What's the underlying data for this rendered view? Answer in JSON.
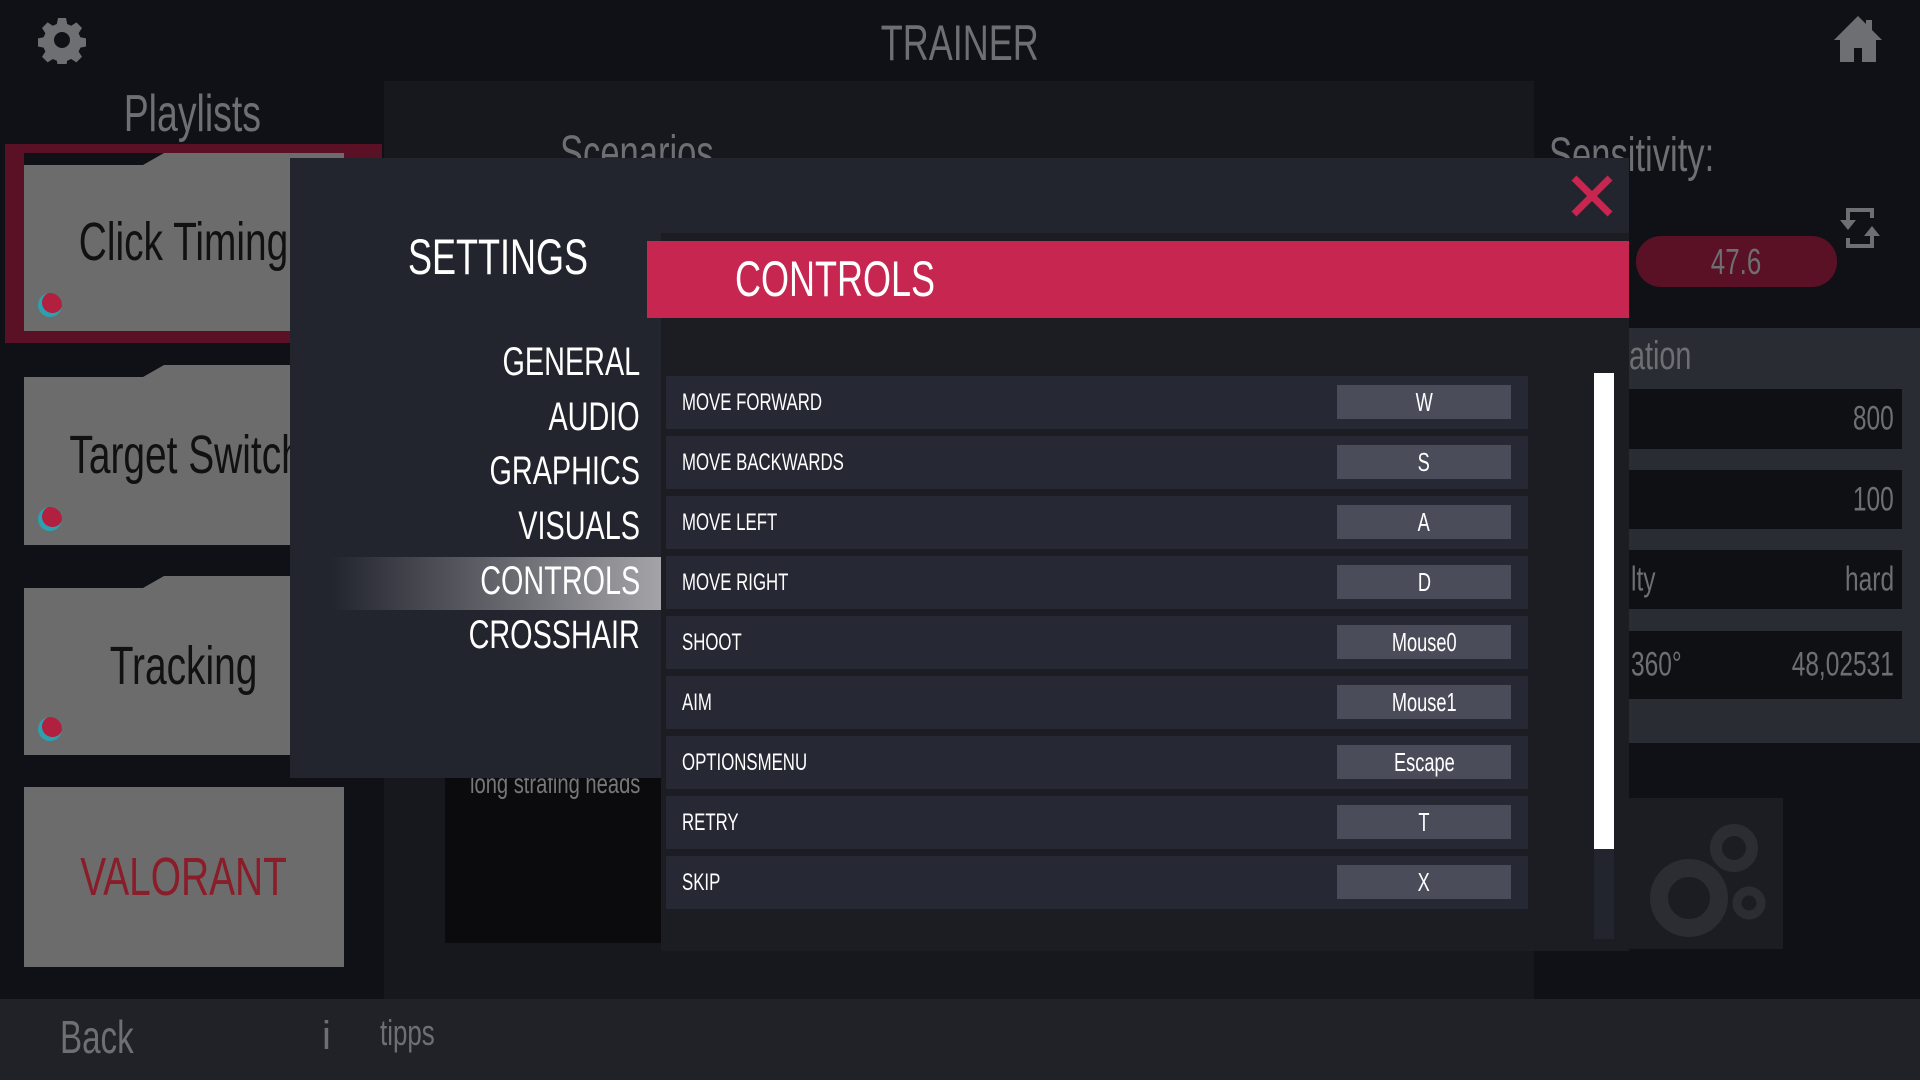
{
  "header": {
    "title": "TRAINER",
    "settings_icon": "gear-icon",
    "home_icon": "home-icon"
  },
  "playlists": {
    "title": "Playlists",
    "items": [
      {
        "label": "Click Timing",
        "selected": true
      },
      {
        "label": "Target Switch"
      },
      {
        "label": "Tracking"
      },
      {
        "label": "VALORANT"
      }
    ]
  },
  "scenarios": {
    "title": "Scenarios",
    "description": "long strafing heads"
  },
  "right_panel": {
    "sensitivity_label": "Sensitivity:",
    "sensitivity_value": "47.6",
    "section_label": "ation",
    "rows": [
      {
        "key": "",
        "value": "800"
      },
      {
        "key": "",
        "value": "100"
      },
      {
        "key": "lty",
        "value": "hard"
      },
      {
        "key": "360°",
        "value": "48,02531"
      }
    ]
  },
  "footer": {
    "back": "Back",
    "info": "i",
    "tipps": "tipps"
  },
  "settings": {
    "title": "SETTINGS",
    "menu": [
      "GENERAL",
      "AUDIO",
      "GRAPHICS",
      "VISUALS",
      "CONTROLS",
      "CROSSHAIR"
    ],
    "active": "CONTROLS",
    "section_title": "CONTROLS",
    "controls": [
      {
        "action": "MOVE FORWARD",
        "key": "W"
      },
      {
        "action": "MOVE BACKWARDS",
        "key": "S"
      },
      {
        "action": "MOVE LEFT",
        "key": "A"
      },
      {
        "action": "MOVE RIGHT",
        "key": "D"
      },
      {
        "action": "SHOOT",
        "key": "Mouse0"
      },
      {
        "action": "AIM",
        "key": "Mouse1"
      },
      {
        "action": "OPTIONSMENU",
        "key": "Escape"
      },
      {
        "action": "RETRY",
        "key": "T"
      },
      {
        "action": "SKIP",
        "key": "X"
      }
    ]
  },
  "colors": {
    "accent": "#c62650",
    "modal": "#23252e",
    "background": "#101116"
  }
}
